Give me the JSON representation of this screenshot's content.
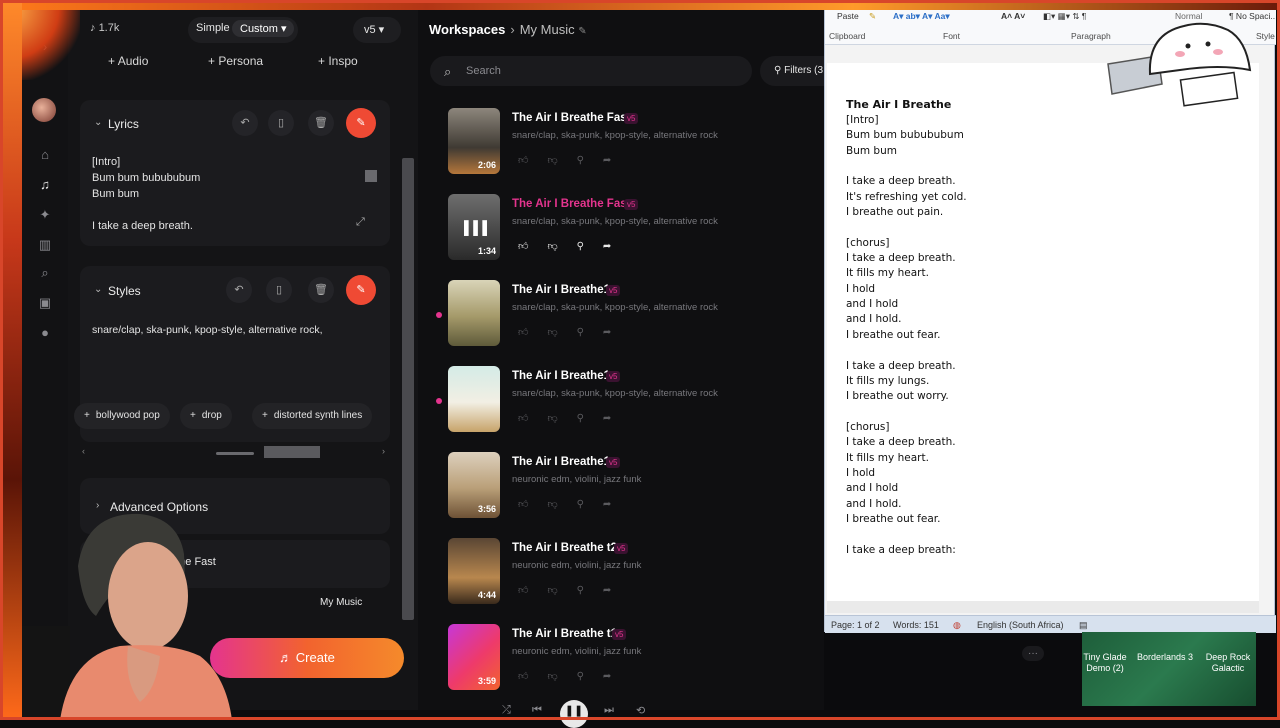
{
  "app": {
    "credits": "1.7k",
    "mode_simple": "Simple",
    "mode_custom": "Custom",
    "version": "v5",
    "add_audio": "Audio",
    "add_persona": "Persona",
    "add_inspo": "Inspo",
    "lyrics_label": "Lyrics",
    "lyrics_text": "[Intro]\nBum bum bubububum\nBum bum\n\nI take a deep breath.",
    "styles_label": "Styles",
    "styles_text": "snare/clap, ska-punk, kpop-style, alternative rock,",
    "suggest_chips": [
      "bollywood pop",
      "drop",
      "distorted synth lines"
    ],
    "advanced_label": "Advanced Options",
    "song_title_fragment": "athe Fast",
    "workspace_button": "My Music",
    "create_label": "Create",
    "accent": "#e4348e"
  },
  "workspace": {
    "crumb_root": "Workspaces",
    "crumb_current": "My Music",
    "search_placeholder": "Search",
    "filters_label": "Filters (3",
    "songs": [
      {
        "title": "The Air I Breathe Fast",
        "version": "v5",
        "tags": "snare/clap, ska-punk, kpop-style, alternative rock",
        "duration": "2:06"
      },
      {
        "title": "The Air I Breathe Fast",
        "version": "v5",
        "tags": "snare/clap, ska-punk, kpop-style, alternative rock",
        "duration": "1:34"
      },
      {
        "title": "The Air I Breathe1",
        "version": "v5",
        "tags": "snare/clap, ska-punk, kpop-style, alternative rock",
        "duration": ""
      },
      {
        "title": "The Air I Breathe1",
        "version": "v5",
        "tags": "snare/clap, ska-punk, kpop-style, alternative rock",
        "duration": ""
      },
      {
        "title": "The Air I Breathe1",
        "version": "v5",
        "tags": "neuronic edm, violini, jazz funk",
        "duration": "3:56"
      },
      {
        "title": "The Air I Breathe t2",
        "version": "v5",
        "tags": "neuronic edm, violini, jazz funk",
        "duration": "4:44"
      },
      {
        "title": "The Air I Breathe t1",
        "version": "v5",
        "tags": "neuronic edm, violini, jazz funk",
        "duration": "3:59"
      }
    ]
  },
  "word": {
    "paste": "Paste",
    "clipboard": "Clipboard",
    "font": "Font",
    "paragraph": "Paragraph",
    "styles": "Style",
    "style_normal": "Normal",
    "style_nospacing": "¶ No Spaci...",
    "doc_title": "The Air I Breathe",
    "doc_body": "[Intro]\nBum bum bubububum\nBum bum\n\nI take a deep breath.\nIt's refreshing yet cold.\nI breathe out pain.\n\n[chorus]\nI take a deep breath.\nIt fills my heart.\nI hold\nand I hold\nand I hold.\nI breathe out fear.\n\nI take a deep breath.\nIt fills my lungs.\nI breathe out worry.\n\n[chorus]\nI take a deep breath.\nIt fills my heart.\nI hold\nand I hold\nand I hold.\nI breathe out fear.\n\nI take a deep breath:",
    "page": "Page: 1 of 2",
    "words": "Words: 151",
    "language": "English (South Africa)"
  },
  "desktop": {
    "items": [
      "Tiny Glade Demo (2)",
      "Borderlands 3",
      "Deep Rock Galactic"
    ]
  }
}
